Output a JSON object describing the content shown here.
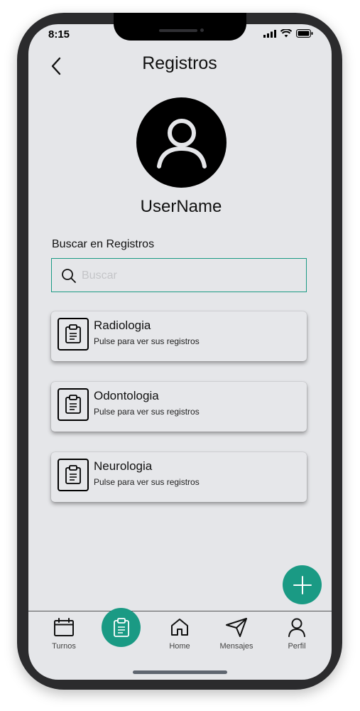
{
  "status_bar": {
    "time": "8:15"
  },
  "header": {
    "title": "Registros"
  },
  "profile": {
    "username": "UserName"
  },
  "search": {
    "label": "Buscar en Registros",
    "placeholder": "Buscar",
    "value": ""
  },
  "records": [
    {
      "title": "Radiologia",
      "subtitle": "Pulse para ver sus registros"
    },
    {
      "title": "Odontologia",
      "subtitle": "Pulse para ver sus registros"
    },
    {
      "title": "Neurologia",
      "subtitle": "Pulse para ver sus registros"
    }
  ],
  "bottom_nav": {
    "items": [
      {
        "label": "Turnos",
        "icon": "calendar-icon"
      },
      {
        "label": "",
        "icon": "clipboard-icon"
      },
      {
        "label": "Home",
        "icon": "home-icon"
      },
      {
        "label": "Mensajes",
        "icon": "send-icon"
      },
      {
        "label": "Perfil",
        "icon": "user-icon"
      }
    ]
  },
  "colors": {
    "accent": "#1a9a84",
    "background": "#e5e6e9"
  }
}
